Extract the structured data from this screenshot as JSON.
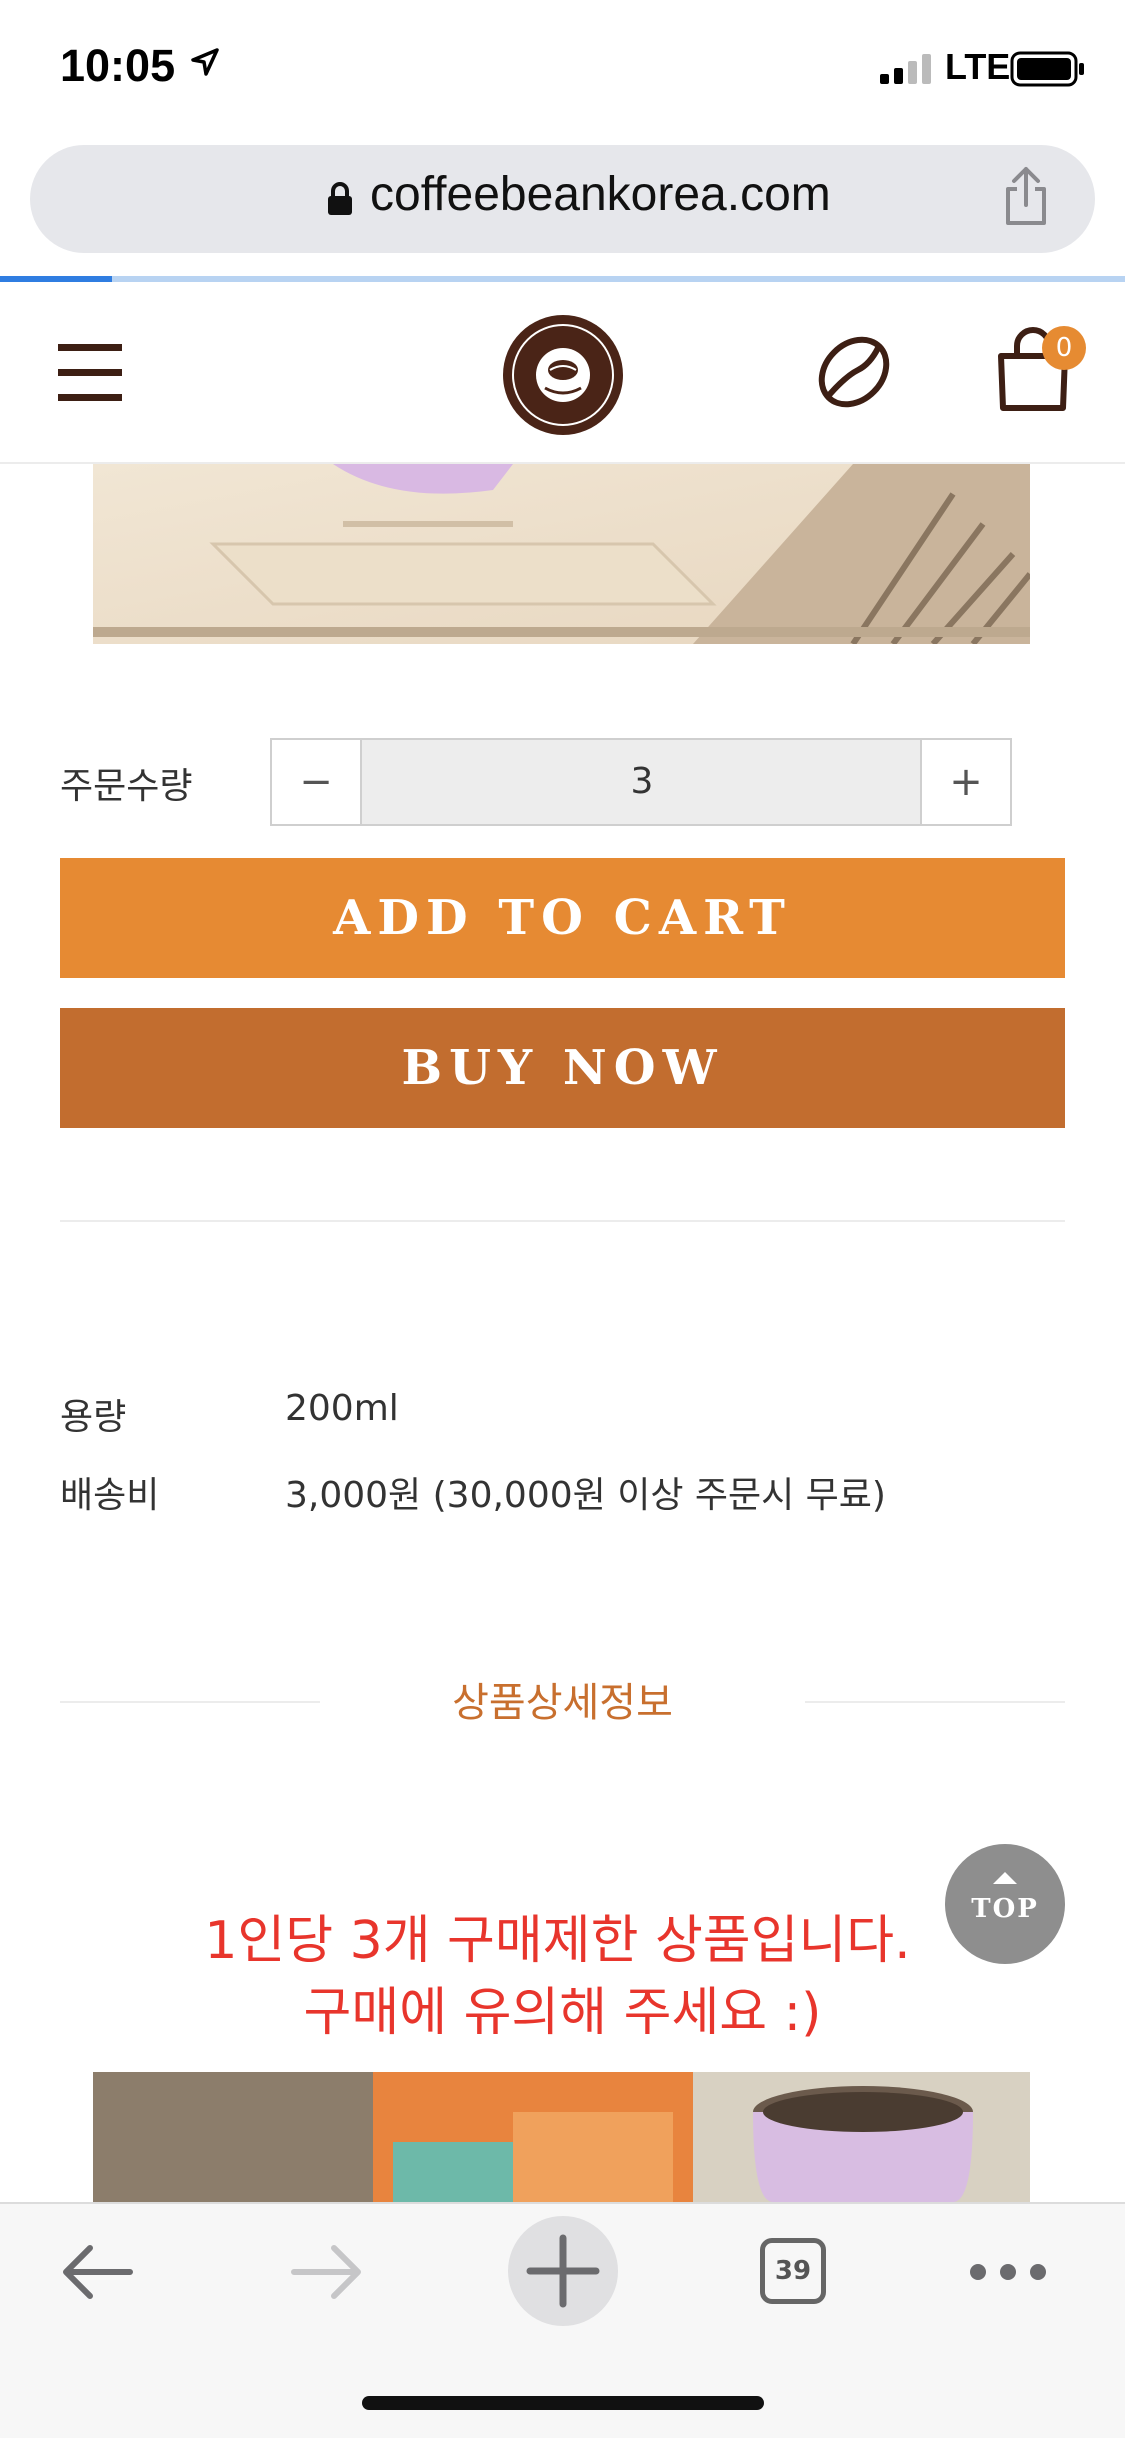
{
  "status_bar": {
    "time": "10:05",
    "network": "LTE"
  },
  "browser": {
    "url": "coffeebeankorea.com",
    "tab_count": "39"
  },
  "header": {
    "cart_count": "0"
  },
  "quantity": {
    "label": "주문수량",
    "value": "3",
    "minus": "−",
    "plus": "+"
  },
  "buttons": {
    "add_to_cart": "ADD TO CART",
    "buy_now": "BUY NOW"
  },
  "specs": [
    {
      "key": "용량",
      "value": "200ml"
    },
    {
      "key": "배송비",
      "value": "3,000원 (30,000원 이상 주문시 무료)"
    }
  ],
  "detail": {
    "title": "상품상세정보",
    "notice_line1": "1인당 3개 구매제한 상품입니다.",
    "notice_line2": "구매에 유의해 주세요 :)"
  },
  "top_button": "TOP",
  "colors": {
    "accent": "#e68a33",
    "buy_now": "#c26d2f",
    "brand_brown": "#3d1f14",
    "notice_red": "#e8352c"
  }
}
